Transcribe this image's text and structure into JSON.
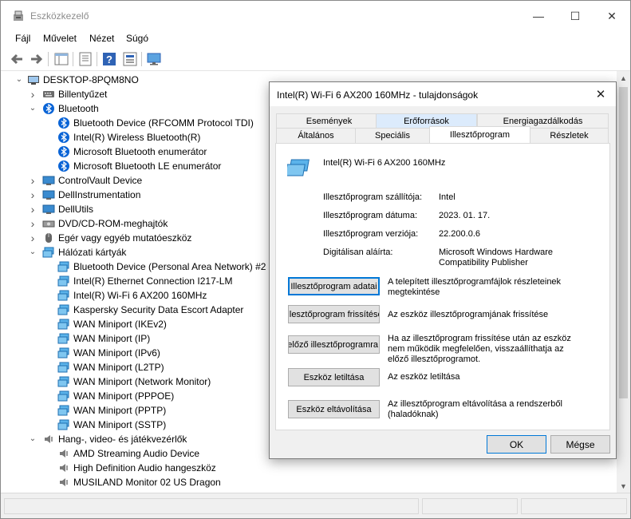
{
  "window": {
    "title": "Eszközkezelő",
    "minimize_icon": "minimize-icon",
    "maximize_icon": "maximize-icon",
    "close_icon": "close-icon"
  },
  "menu": [
    "Fájl",
    "Művelet",
    "Nézet",
    "Súgó"
  ],
  "toolbar": [
    "back-arrow-icon",
    "forward-arrow-icon",
    "show-hide-console-tree-icon",
    "properties-icon",
    "help-icon",
    "update-driver-icon",
    "monitor-icon"
  ],
  "tree": {
    "root": "DESKTOP-8PQM8NO",
    "items": [
      {
        "label": "Billentyűzet",
        "level": 1,
        "expand": "collapsed",
        "icon": "keyboard-icon"
      },
      {
        "label": "Bluetooth",
        "level": 1,
        "expand": "expanded",
        "icon": "bluetooth-icon"
      },
      {
        "label": "Bluetooth Device (RFCOMM Protocol TDI)",
        "level": 2,
        "expand": "none",
        "icon": "bluetooth-icon"
      },
      {
        "label": "Intel(R) Wireless Bluetooth(R)",
        "level": 2,
        "expand": "none",
        "icon": "bluetooth-icon"
      },
      {
        "label": "Microsoft Bluetooth enumerátor",
        "level": 2,
        "expand": "none",
        "icon": "bluetooth-icon"
      },
      {
        "label": "Microsoft Bluetooth LE enumerátor",
        "level": 2,
        "expand": "none",
        "icon": "bluetooth-icon"
      },
      {
        "label": "ControlVault Device",
        "level": 1,
        "expand": "collapsed",
        "icon": "device-icon"
      },
      {
        "label": "DellInstrumentation",
        "level": 1,
        "expand": "collapsed",
        "icon": "device-icon"
      },
      {
        "label": "DellUtils",
        "level": 1,
        "expand": "collapsed",
        "icon": "device-icon"
      },
      {
        "label": "DVD/CD-ROM-meghajtók",
        "level": 1,
        "expand": "collapsed",
        "icon": "dvd-drive-icon"
      },
      {
        "label": "Egér vagy egyéb mutatóeszköz",
        "level": 1,
        "expand": "collapsed",
        "icon": "mouse-icon"
      },
      {
        "label": "Hálózati kártyák",
        "level": 1,
        "expand": "expanded",
        "icon": "network-adapter-icon"
      },
      {
        "label": "Bluetooth Device (Personal Area Network) #2",
        "level": 2,
        "expand": "none",
        "icon": "network-adapter-icon"
      },
      {
        "label": "Intel(R) Ethernet Connection I217-LM",
        "level": 2,
        "expand": "none",
        "icon": "network-adapter-icon"
      },
      {
        "label": "Intel(R) Wi-Fi 6 AX200 160MHz",
        "level": 2,
        "expand": "none",
        "icon": "network-adapter-icon"
      },
      {
        "label": "Kaspersky Security Data Escort Adapter",
        "level": 2,
        "expand": "none",
        "icon": "network-adapter-icon"
      },
      {
        "label": "WAN Miniport (IKEv2)",
        "level": 2,
        "expand": "none",
        "icon": "network-adapter-icon"
      },
      {
        "label": "WAN Miniport (IP)",
        "level": 2,
        "expand": "none",
        "icon": "network-adapter-icon"
      },
      {
        "label": "WAN Miniport (IPv6)",
        "level": 2,
        "expand": "none",
        "icon": "network-adapter-icon"
      },
      {
        "label": "WAN Miniport (L2TP)",
        "level": 2,
        "expand": "none",
        "icon": "network-adapter-icon"
      },
      {
        "label": "WAN Miniport (Network Monitor)",
        "level": 2,
        "expand": "none",
        "icon": "network-adapter-icon"
      },
      {
        "label": "WAN Miniport (PPPOE)",
        "level": 2,
        "expand": "none",
        "icon": "network-adapter-icon"
      },
      {
        "label": "WAN Miniport (PPTP)",
        "level": 2,
        "expand": "none",
        "icon": "network-adapter-icon"
      },
      {
        "label": "WAN Miniport (SSTP)",
        "level": 2,
        "expand": "none",
        "icon": "network-adapter-icon"
      },
      {
        "label": "Hang-, video- és játékvezérlők",
        "level": 1,
        "expand": "expanded",
        "icon": "speaker-icon"
      },
      {
        "label": "AMD Streaming Audio Device",
        "level": 2,
        "expand": "none",
        "icon": "speaker-icon"
      },
      {
        "label": "High Definition Audio hangeszköz",
        "level": 2,
        "expand": "none",
        "icon": "speaker-icon"
      },
      {
        "label": "MUSILAND Monitor 02 US Dragon",
        "level": 2,
        "expand": "none",
        "icon": "speaker-icon"
      }
    ]
  },
  "dialog": {
    "title": "Intel(R) Wi-Fi 6 AX200 160MHz - tulajdonságok",
    "tabs_row1": [
      "Események",
      "Erőforrások",
      "Energiagazdálkodás"
    ],
    "tabs_row2": [
      "Általános",
      "Speciális",
      "Illesztőprogram",
      "Részletek"
    ],
    "active_tab": "Illesztőprogram",
    "device_name": "Intel(R) Wi-Fi 6 AX200 160MHz",
    "props": [
      {
        "label": "Illesztőprogram szállítója:",
        "value": "Intel"
      },
      {
        "label": "Illesztőprogram dátuma:",
        "value": "2023. 01. 17."
      },
      {
        "label": "Illesztőprogram verziója:",
        "value": "22.200.0.6"
      },
      {
        "label": "Digitálisan aláírta:",
        "value": "Microsoft Windows Hardware Compatibility Publisher"
      }
    ],
    "actions": [
      {
        "button": "Illesztőprogram adatai",
        "desc": "A telepített illesztőprogramfájlok részleteinek megtekintése"
      },
      {
        "button": "Illesztőprogram frissítése",
        "desc": "Az eszköz illesztőprogramjának frissítése"
      },
      {
        "button": "Visszaállás az előző illesztőprogramra",
        "desc": "Ha az illesztőprogram frissítése után az eszköz nem működik megfelelően, visszaállíthatja az előző illesztőprogramot."
      },
      {
        "button": "Eszköz letiltása",
        "desc": "Az eszköz letiltása"
      },
      {
        "button": "Eszköz eltávolítása",
        "desc": "Az illesztőprogram eltávolítása a rendszerből (haladóknak)"
      }
    ],
    "ok": "OK",
    "cancel": "Mégse"
  },
  "colors": {
    "accent": "#0078d7",
    "bluetooth": "#0a64d6",
    "network": "#2a8fd6"
  }
}
